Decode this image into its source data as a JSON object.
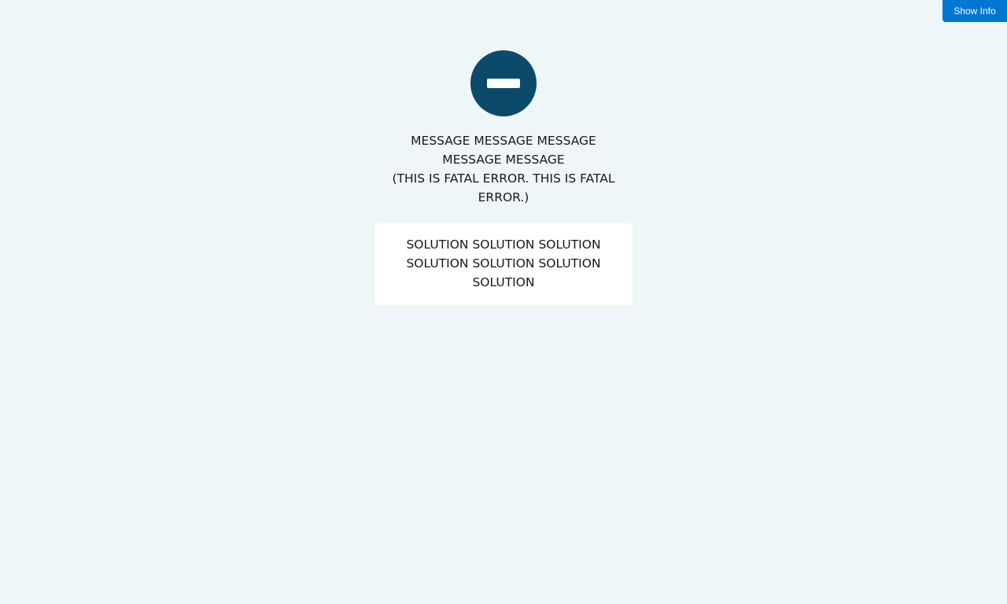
{
  "header": {
    "show_info_label": "Show Info"
  },
  "error": {
    "icon": "minus-circle-icon",
    "message_lines": [
      "MESSAGE MESSAGE MESSAGE",
      "MESSAGE MESSAGE"
    ],
    "detail_lines": [
      "(THIS IS FATAL ERROR. THIS IS FATAL",
      "ERROR.)"
    ]
  },
  "solution": {
    "lines": [
      "SOLUTION SOLUTION SOLUTION",
      "SOLUTION SOLUTION SOLUTION",
      "SOLUTION"
    ]
  },
  "colors": {
    "background": "#eff6f9",
    "accent_button": "#0176d3",
    "icon": "#0b4a6b",
    "text": "#181818"
  }
}
